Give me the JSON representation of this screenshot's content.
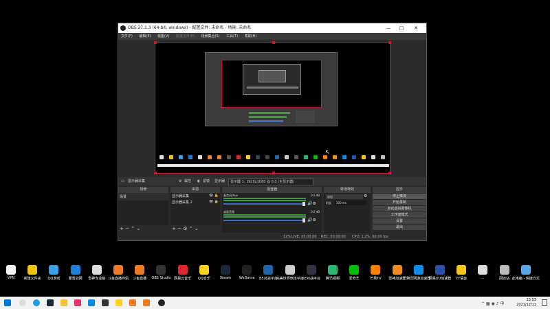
{
  "window": {
    "title": "OBS 27.1.3 (64-bit, windows) - 配置文件: 未命名 - 场景: 未命名",
    "menu": [
      "文件(F)",
      "编辑(E)",
      "视图(V)",
      "配置文件(P)",
      "场景集合(S)",
      "工具(T)",
      "帮助(H)"
    ],
    "controls": [
      "—",
      "□",
      "✕"
    ]
  },
  "preview_bar": {
    "source": "显示器采集",
    "properties": "属性",
    "filters": "滤镜",
    "display_label": "显示器",
    "display_value": "显示器 1: 1920x1080 @ 0,0 (主显示器)"
  },
  "panels": {
    "scenes": {
      "title": "场景",
      "items": [
        "场景"
      ]
    },
    "sources": {
      "title": "来源",
      "items": [
        "显示器采集",
        "显示器采集 2"
      ]
    },
    "mixer": {
      "title": "混音器",
      "channels": [
        {
          "name": "麦克风/Aux",
          "db": "0.0 dB"
        },
        {
          "name": "桌面音频",
          "db": "0.0 dB"
        }
      ]
    },
    "transitions": {
      "title": "转场特效",
      "type": "淡出",
      "duration_label": "时长",
      "duration": "300 ms"
    },
    "controls": {
      "title": "控件",
      "buttons": [
        "停止推流",
        "开始录制",
        "启动虚拟摄像机",
        "工作室模式",
        "设置",
        "退出"
      ]
    }
  },
  "status": {
    "live": "LIVE: 00:00:00",
    "rec": "REC: 00:00:00",
    "cpu": "CPU: 1.2%, 60.00 fps",
    "net": "12%"
  },
  "desktop": {
    "icons": [
      {
        "label": "VPN",
        "color": "#f4f4f4"
      },
      {
        "label": "新建文件夹",
        "color": "#f1c40f"
      },
      {
        "label": "QQ游戏",
        "color": "#3aa0e8"
      },
      {
        "label": "暴雪战网",
        "color": "#1e7fd8"
      },
      {
        "label": "雷神专业版",
        "color": "#ddd"
      },
      {
        "label": "斗鱼直播伴侣",
        "color": "#f07b23"
      },
      {
        "label": "斗鱼直播",
        "color": "#f07b23"
      },
      {
        "label": "OBS Studio",
        "color": "#333"
      },
      {
        "label": "网易云音乐",
        "color": "#e0272f"
      },
      {
        "label": "QQ音乐",
        "color": "#ffd21f"
      },
      {
        "label": "Steam",
        "color": "#1b2838"
      },
      {
        "label": "WeGame",
        "color": "#222"
      },
      {
        "label": "B5对战平台",
        "color": "#2266aa"
      },
      {
        "label": "完美世界竞技平台",
        "color": "#ccc"
      },
      {
        "label": "5E对战平台",
        "color": "#334"
      },
      {
        "label": "腾讯视频",
        "color": "#2bb673"
      },
      {
        "label": "爱奇艺",
        "color": "#00be06"
      },
      {
        "label": "芒果TV",
        "color": "#ff7e00"
      },
      {
        "label": "雷神加速器",
        "color": "#f28c1e"
      },
      {
        "label": "腾讯网游加速器",
        "color": "#0a8ce8"
      },
      {
        "label": "网易UU加速器",
        "color": "#2c4fa8"
      },
      {
        "label": "YY语音",
        "color": "#f5c518"
      },
      {
        "label": "...",
        "color": "#ddd"
      },
      {
        "label": "回收站",
        "color": "#bbb"
      },
      {
        "label": "此电脑 - 快捷方式",
        "color": "#5aa5e6"
      }
    ]
  },
  "taskbar": {
    "time": "23:53",
    "date": "2021/12/11",
    "icons": [
      "windows-start",
      "search",
      "edge",
      "chrome",
      "steam",
      "explorer",
      "store",
      "qq",
      "wegame",
      "app",
      "douyu",
      "obs"
    ]
  }
}
